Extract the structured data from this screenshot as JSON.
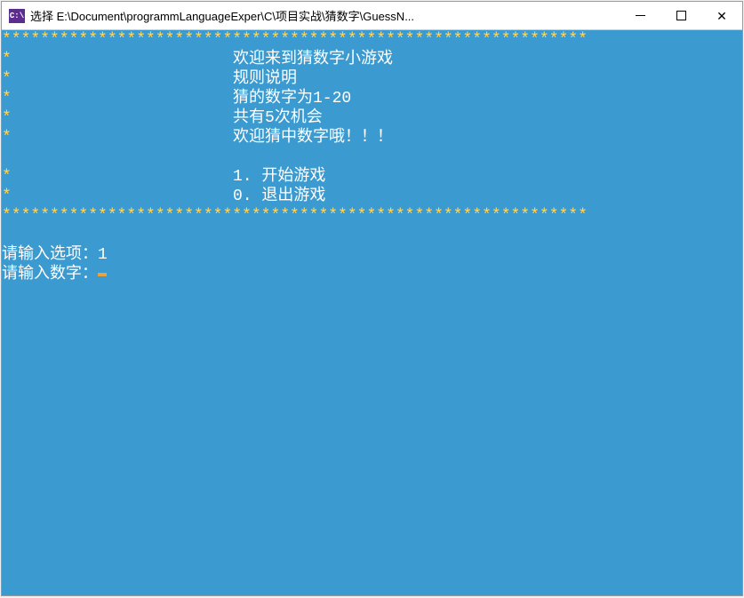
{
  "titlebar": {
    "icon_text": "C:\\",
    "title": "选择 E:\\Document\\programmLanguageExper\\C\\项目实战\\猜数字\\GuessN..."
  },
  "console": {
    "star_border": "*************************************************************",
    "lines": {
      "welcome": "欢迎来到猜数字小游戏",
      "rules_label": "规则说明",
      "range": "猜的数字为1-20",
      "chances": "共有5次机会",
      "encourage": "欢迎猜中数字哦！！！",
      "option_start": "1. 开始游戏",
      "option_exit": "0. 退出游戏"
    },
    "prompt_option_label": "请输入选项：",
    "prompt_option_value": "1",
    "prompt_number_label": "请输入数字："
  }
}
